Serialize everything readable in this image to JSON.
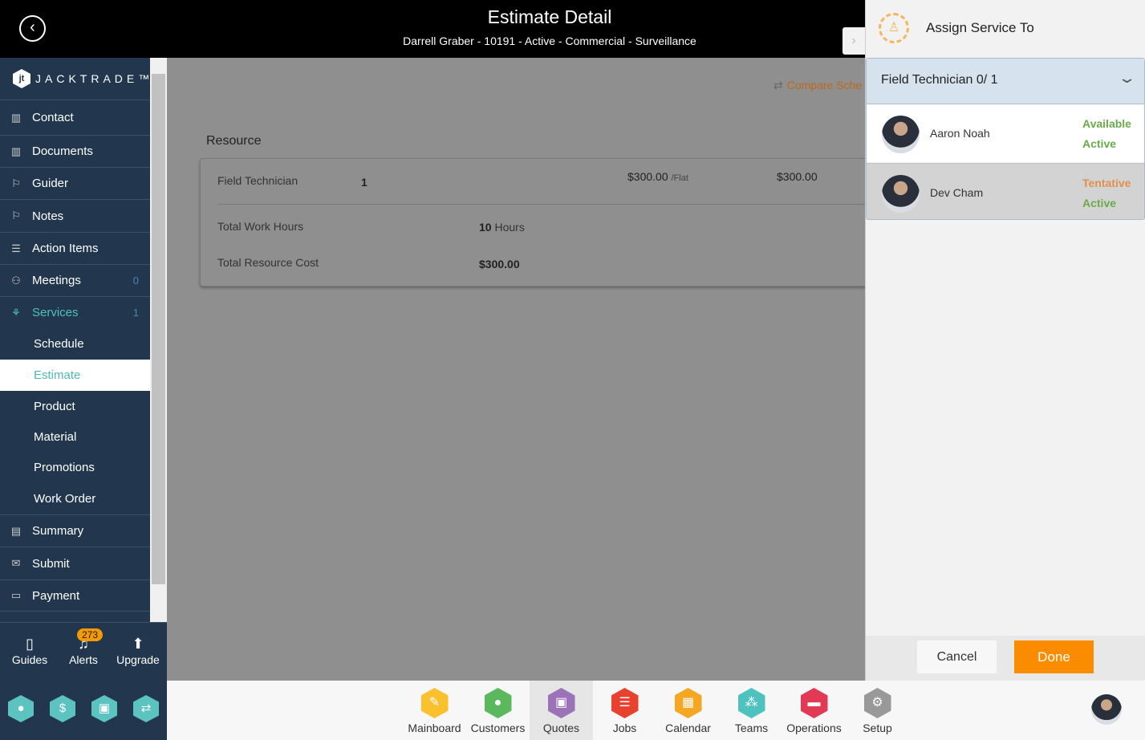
{
  "header": {
    "title": "Estimate Detail",
    "subtitle": "Darrell Graber - 10191 - Active - Commercial - Surveillance",
    "back_icon": "chevron-left-circle-icon"
  },
  "brand": {
    "name": "JACKTRADE™",
    "mark": "JT"
  },
  "sidebar": {
    "items": [
      {
        "label": "Contact",
        "icon": "▥"
      },
      {
        "label": "Documents",
        "icon": "▥"
      },
      {
        "label": "Guider",
        "icon": "⚐"
      },
      {
        "label": "Notes",
        "icon": "⚐"
      },
      {
        "label": "Action Items",
        "icon": "☰"
      },
      {
        "label": "Meetings",
        "icon": "⚇",
        "count": "0"
      },
      {
        "label": "Services",
        "icon": "⚘",
        "count": "1"
      }
    ],
    "subitems": [
      {
        "label": "Schedule"
      },
      {
        "label": "Estimate"
      },
      {
        "label": "Product"
      },
      {
        "label": "Material"
      },
      {
        "label": "Promotions"
      },
      {
        "label": "Work Order"
      }
    ],
    "items2": [
      {
        "label": "Summary",
        "icon": "▤"
      },
      {
        "label": "Submit",
        "icon": "✉"
      },
      {
        "label": "Payment",
        "icon": "▭"
      }
    ]
  },
  "bottom_nav": {
    "guides": "Guides",
    "alerts": "Alerts",
    "alerts_badge": "273",
    "upgrade": "Upgrade"
  },
  "main": {
    "compare": "Compare Sche",
    "resource_label": "Resource",
    "card": {
      "role": "Field Technician",
      "qty": "1",
      "rate": "$300.00",
      "rate_unit": "/Flat",
      "total": "$300.00",
      "hours_label": "Total Work Hours",
      "hours_value": "10",
      "hours_unit": "Hours",
      "cost_label": "Total Resource Cost",
      "cost_value": "$300.00"
    }
  },
  "panel": {
    "title": "Assign Service To",
    "group_title": "Field Technician 0/ 1",
    "people": [
      {
        "name": "Aaron Noah",
        "availability": "Available",
        "status": "Active",
        "availability_color": "#6aab4c"
      },
      {
        "name": "Dev Cham",
        "availability": "Tentative",
        "status": "Active",
        "availability_color": "#e0904a"
      }
    ],
    "cancel": "Cancel",
    "done": "Done"
  },
  "apps": [
    {
      "label": "Mainboard",
      "color": "#fbc02d",
      "icon": "✎"
    },
    {
      "label": "Customers",
      "color": "#5cb85c",
      "icon": "●"
    },
    {
      "label": "Quotes",
      "color": "#9c73b8",
      "icon": "▣"
    },
    {
      "label": "Jobs",
      "color": "#e8412f",
      "icon": "☰"
    },
    {
      "label": "Calendar",
      "color": "#f5a623",
      "icon": "▦"
    },
    {
      "label": "Teams",
      "color": "#4fc2c0",
      "icon": "⁂"
    },
    {
      "label": "Operations",
      "color": "#e23a55",
      "icon": "▬"
    },
    {
      "label": "Setup",
      "color": "#999999",
      "icon": "⚙"
    }
  ]
}
